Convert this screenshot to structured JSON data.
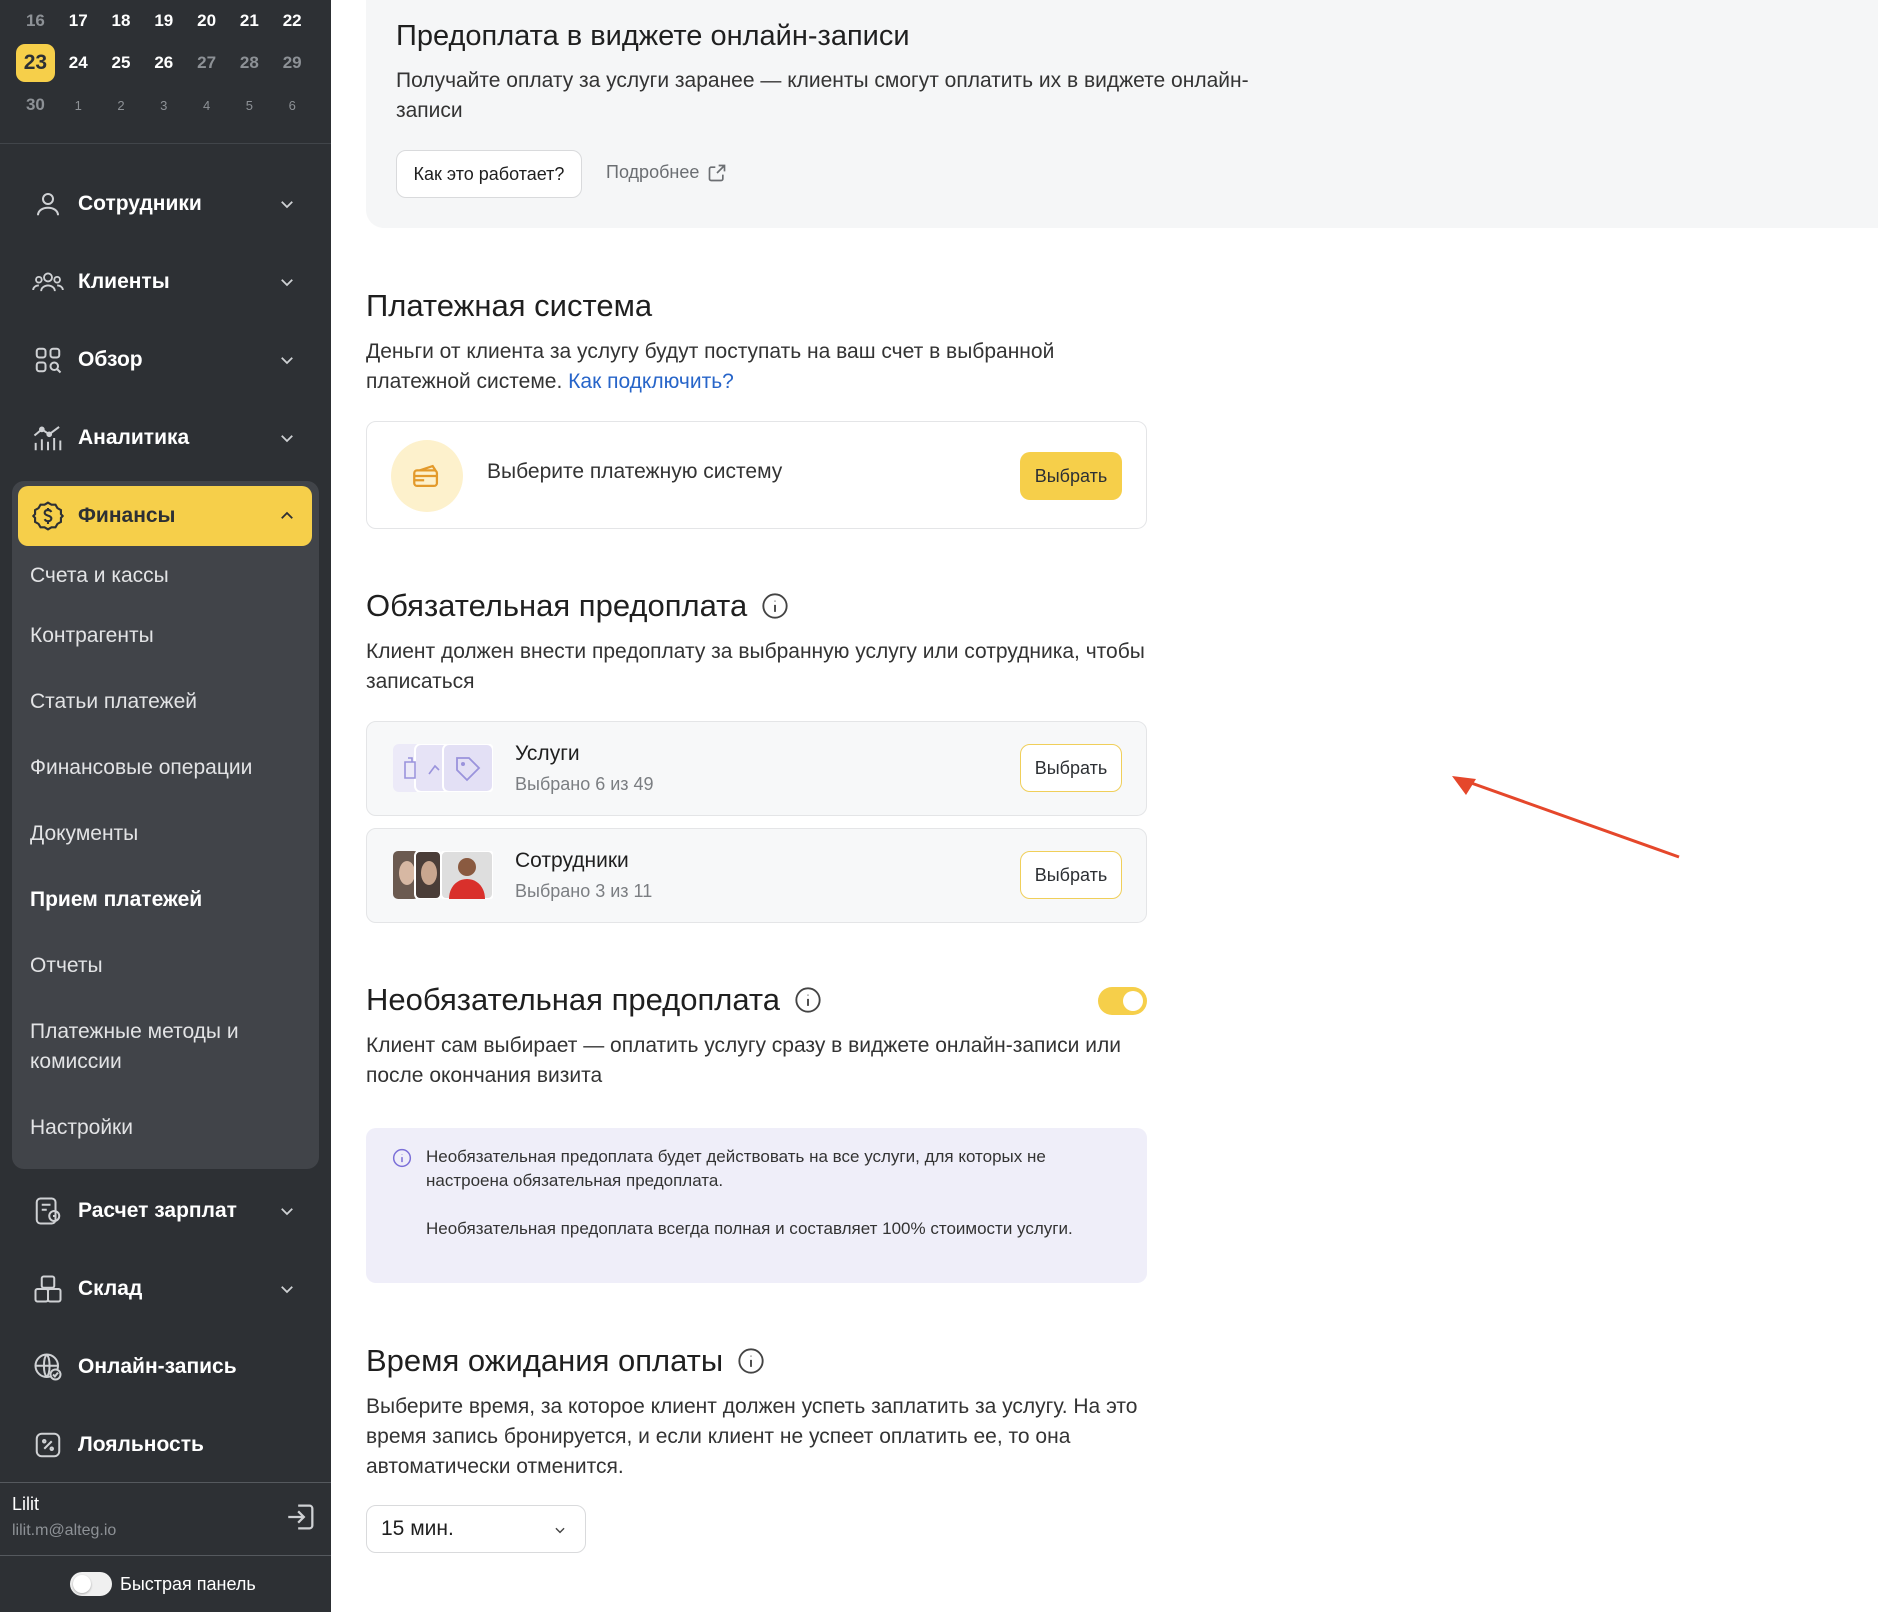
{
  "calendar": {
    "rows": [
      [
        "16",
        "17",
        "18",
        "19",
        "20",
        "21",
        "22"
      ],
      [
        "23",
        "24",
        "25",
        "26",
        "27",
        "28",
        "29"
      ],
      [
        "30",
        "1",
        "2",
        "3",
        "4",
        "5",
        "6"
      ]
    ]
  },
  "sidebar": {
    "items": [
      {
        "label": "Сотрудники"
      },
      {
        "label": "Клиенты"
      },
      {
        "label": "Обзор"
      },
      {
        "label": "Аналитика"
      },
      {
        "label": "Финансы"
      },
      {
        "label": "Расчет зарплат"
      },
      {
        "label": "Склад"
      },
      {
        "label": "Онлайн-запись"
      },
      {
        "label": "Лояльность"
      }
    ],
    "finance_sub": [
      "Счета и кассы",
      "Контрагенты",
      "Статьи платежей",
      "Финансовые операции",
      "Документы",
      "Прием платежей",
      "Отчеты",
      "Платежные методы и комиссии",
      "Настройки"
    ],
    "user": {
      "name": "Lilit",
      "email": "lilit.m@alteg.io"
    },
    "quick_panel": "Быстрая панель"
  },
  "top_card": {
    "title": "Предоплата в виджете онлайн-записи",
    "description": "Получайте оплату за услуги заранее — клиенты смогут оплатить их в виджете онлайн-записи",
    "how_button": "Как это работает?",
    "more_link": "Подробнее"
  },
  "payment_system": {
    "title": "Платежная система",
    "description": "Деньги от клиента за услугу будут поступать на ваш счет в выбранной платежной системе.",
    "connect_link": "Как подключить?",
    "card_text": "Выберите платежную систему",
    "select_button": "Выбрать"
  },
  "mandatory": {
    "title": "Обязательная предоплата",
    "description": "Клиент должен внести предоплату за выбранную услугу или сотрудника, чтобы записаться",
    "services": {
      "title": "Услуги",
      "subtitle": "Выбрано 6 из 49",
      "button": "Выбрать"
    },
    "staff": {
      "title": "Сотрудники",
      "subtitle": "Выбрано 3 из 11",
      "button": "Выбрать"
    }
  },
  "optional": {
    "title": "Необязательная предоплата",
    "enabled": true,
    "description": "Клиент сам выбирает — оплатить услугу сразу в виджете онлайн-записи или после окончания визита",
    "notice_1": "Необязательная предоплата будет действовать на все услуги, для которых не настроена обязательная предоплата.",
    "notice_2": "Необязательная предоплата всегда полная и составляет 100% стоимости услуги."
  },
  "wait_time": {
    "title": "Время ожидания оплаты",
    "description": "Выберите время, за которое клиент должен успеть заплатить за услугу. На это время запись бронируется, и если клиент не успеет оплатить ее, то она автоматически отменится.",
    "selected": "15 мин."
  },
  "colors": {
    "accent": "#f6cf4a",
    "sidebar_bg": "#2d3034",
    "link": "#2765c9",
    "annotation_arrow": "#e5472b"
  }
}
